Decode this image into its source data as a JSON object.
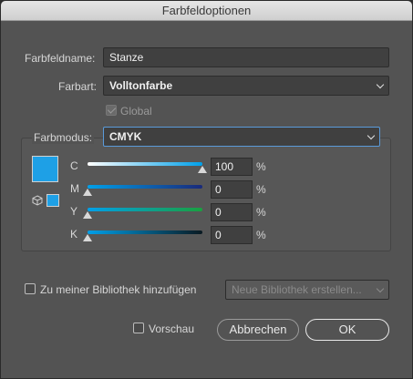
{
  "dialog": {
    "title": "Farbfeldoptionen",
    "name_label": "Farbfeldname:",
    "name_value": "Stanze",
    "type_label": "Farbart:",
    "type_value": "Volltonfarbe",
    "global_label": "Global",
    "mode_label": "Farbmodus:",
    "mode_value": "CMYK",
    "swatch_color": "#1ea0e6",
    "channels": [
      {
        "label": "C",
        "value": "100",
        "unit": "%",
        "level": 1.0,
        "gradient": "linear-gradient(to right, #ffffff, #00a0e9)"
      },
      {
        "label": "M",
        "value": "0",
        "unit": "%",
        "level": 0.0,
        "gradient": "linear-gradient(to right, #00a0e9, #1a2a7a)"
      },
      {
        "label": "Y",
        "value": "0",
        "unit": "%",
        "level": 0.0,
        "gradient": "linear-gradient(to right, #00a0e9, #1aa040)"
      },
      {
        "label": "K",
        "value": "0",
        "unit": "%",
        "level": 0.0,
        "gradient": "linear-gradient(to right, #00a0e9, #0a1a22)"
      }
    ],
    "library_label": "Zu meiner Bibliothek hinzufügen",
    "library_select": "Neue Bibliothek erstellen...",
    "preview_label": "Vorschau",
    "cancel_label": "Abbrechen",
    "ok_label": "OK"
  }
}
